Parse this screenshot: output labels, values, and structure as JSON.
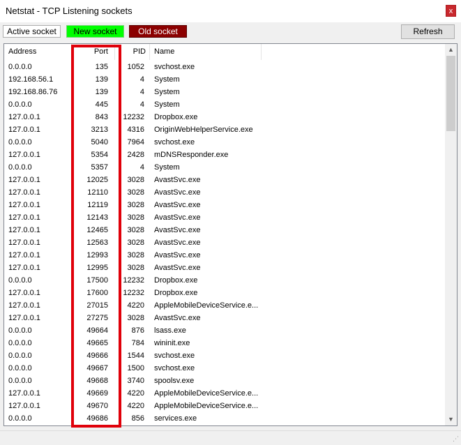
{
  "window": {
    "title": "Netstat - TCP Listening sockets",
    "close_label": "x"
  },
  "toolbar": {
    "active_label": "Active socket",
    "new_label": "New socket",
    "old_label": "Old socket",
    "refresh_label": "Refresh"
  },
  "colors": {
    "new_socket": "#00ff00",
    "old_socket": "#8b0000",
    "highlight": "#e0000a"
  },
  "columns": {
    "address": "Address",
    "port": "Port",
    "pid": "PID",
    "name": "Name"
  },
  "rows": [
    {
      "address": "0.0.0.0",
      "port": "135",
      "pid": "1052",
      "name": "svchost.exe"
    },
    {
      "address": "192.168.56.1",
      "port": "139",
      "pid": "4",
      "name": "System"
    },
    {
      "address": "192.168.86.76",
      "port": "139",
      "pid": "4",
      "name": "System"
    },
    {
      "address": "0.0.0.0",
      "port": "445",
      "pid": "4",
      "name": "System"
    },
    {
      "address": "127.0.0.1",
      "port": "843",
      "pid": "12232",
      "name": "Dropbox.exe"
    },
    {
      "address": "127.0.0.1",
      "port": "3213",
      "pid": "4316",
      "name": "OriginWebHelperService.exe"
    },
    {
      "address": "0.0.0.0",
      "port": "5040",
      "pid": "7964",
      "name": "svchost.exe"
    },
    {
      "address": "127.0.0.1",
      "port": "5354",
      "pid": "2428",
      "name": "mDNSResponder.exe"
    },
    {
      "address": "0.0.0.0",
      "port": "5357",
      "pid": "4",
      "name": "System"
    },
    {
      "address": "127.0.0.1",
      "port": "12025",
      "pid": "3028",
      "name": "AvastSvc.exe"
    },
    {
      "address": "127.0.0.1",
      "port": "12110",
      "pid": "3028",
      "name": "AvastSvc.exe"
    },
    {
      "address": "127.0.0.1",
      "port": "12119",
      "pid": "3028",
      "name": "AvastSvc.exe"
    },
    {
      "address": "127.0.0.1",
      "port": "12143",
      "pid": "3028",
      "name": "AvastSvc.exe"
    },
    {
      "address": "127.0.0.1",
      "port": "12465",
      "pid": "3028",
      "name": "AvastSvc.exe"
    },
    {
      "address": "127.0.0.1",
      "port": "12563",
      "pid": "3028",
      "name": "AvastSvc.exe"
    },
    {
      "address": "127.0.0.1",
      "port": "12993",
      "pid": "3028",
      "name": "AvastSvc.exe"
    },
    {
      "address": "127.0.0.1",
      "port": "12995",
      "pid": "3028",
      "name": "AvastSvc.exe"
    },
    {
      "address": "0.0.0.0",
      "port": "17500",
      "pid": "12232",
      "name": "Dropbox.exe"
    },
    {
      "address": "127.0.0.1",
      "port": "17600",
      "pid": "12232",
      "name": "Dropbox.exe"
    },
    {
      "address": "127.0.0.1",
      "port": "27015",
      "pid": "4220",
      "name": "AppleMobileDeviceService.e..."
    },
    {
      "address": "127.0.0.1",
      "port": "27275",
      "pid": "3028",
      "name": "AvastSvc.exe"
    },
    {
      "address": "0.0.0.0",
      "port": "49664",
      "pid": "876",
      "name": "lsass.exe"
    },
    {
      "address": "0.0.0.0",
      "port": "49665",
      "pid": "784",
      "name": "wininit.exe"
    },
    {
      "address": "0.0.0.0",
      "port": "49666",
      "pid": "1544",
      "name": "svchost.exe"
    },
    {
      "address": "0.0.0.0",
      "port": "49667",
      "pid": "1500",
      "name": "svchost.exe"
    },
    {
      "address": "0.0.0.0",
      "port": "49668",
      "pid": "3740",
      "name": "spoolsv.exe"
    },
    {
      "address": "127.0.0.1",
      "port": "49669",
      "pid": "4220",
      "name": "AppleMobileDeviceService.e..."
    },
    {
      "address": "127.0.0.1",
      "port": "49670",
      "pid": "4220",
      "name": "AppleMobileDeviceService.e..."
    },
    {
      "address": "0.0.0.0",
      "port": "49686",
      "pid": "856",
      "name": "services.exe"
    }
  ]
}
